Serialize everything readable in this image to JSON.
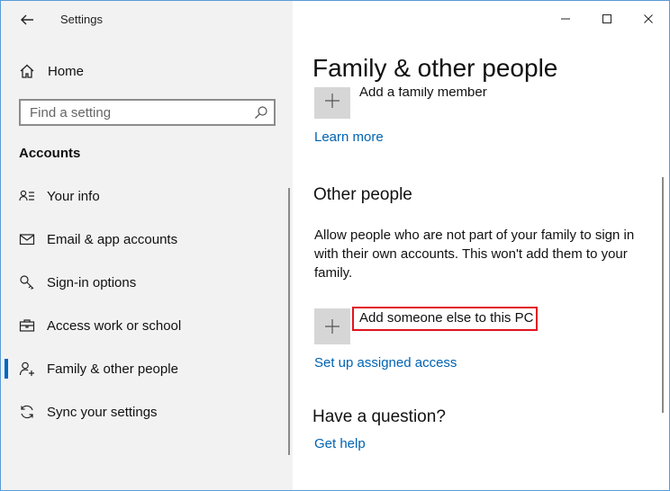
{
  "window": {
    "title": "Settings",
    "controls": [
      "minimize",
      "maximize",
      "close"
    ]
  },
  "sidebar": {
    "home_label": "Home",
    "search": {
      "placeholder": "Find a setting",
      "value": ""
    },
    "section_label": "Accounts",
    "items": [
      {
        "label": "Your info",
        "icon": "person-card-icon",
        "active": false
      },
      {
        "label": "Email & app accounts",
        "icon": "mail-icon",
        "active": false
      },
      {
        "label": "Sign-in options",
        "icon": "key-icon",
        "active": false
      },
      {
        "label": "Access work or school",
        "icon": "briefcase-icon",
        "active": false
      },
      {
        "label": "Family & other people",
        "icon": "person-add-icon",
        "active": true
      },
      {
        "label": "Sync your settings",
        "icon": "sync-icon",
        "active": false
      }
    ]
  },
  "main": {
    "page_title": "Family & other people",
    "family": {
      "add_label": "Add a family member",
      "learn_more": "Learn more"
    },
    "other_people": {
      "heading": "Other people",
      "description": "Allow people who are not part of your family to sign in with their own accounts. This won't add them to your family.",
      "add_label": "Add someone else to this PC",
      "assigned_access": "Set up assigned access"
    },
    "question": {
      "heading": "Have a question?",
      "help_link": "Get help"
    }
  },
  "colors": {
    "accent": "#0067c0",
    "link": "#0063b1",
    "highlight_box": "#e0141e",
    "sidebar_bg": "#f2f2f2"
  }
}
